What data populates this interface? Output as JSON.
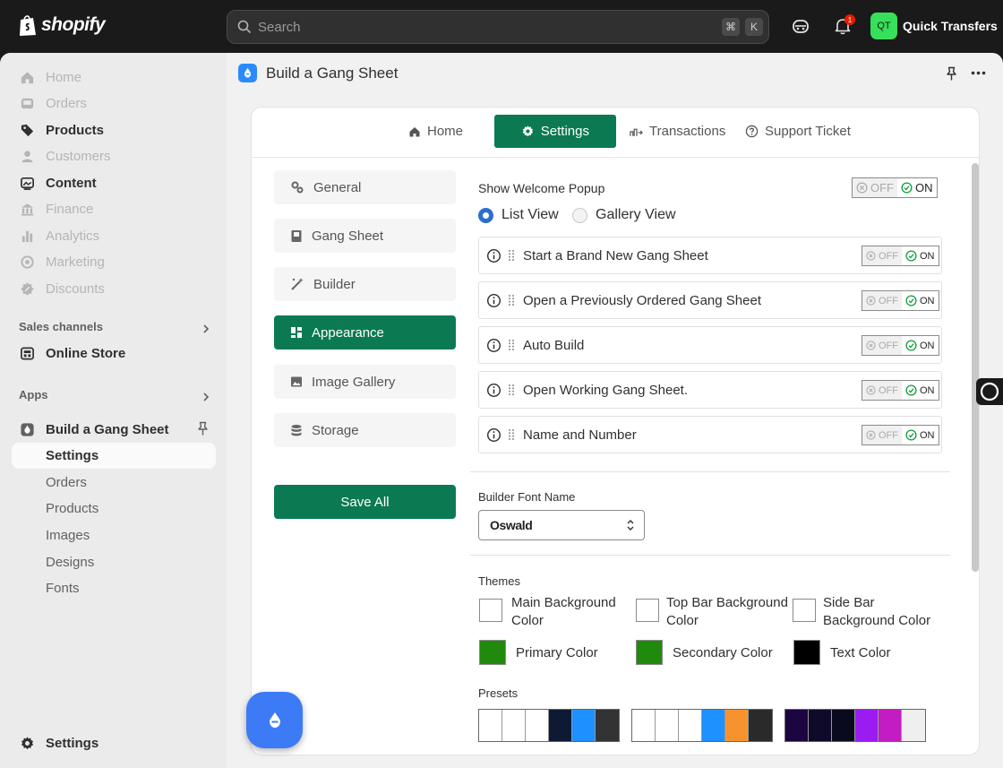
{
  "topbar": {
    "logo_text": "shopify",
    "search_placeholder": "Search",
    "shortcut_keys": [
      "⌘",
      "K"
    ],
    "notification_count": "1",
    "avatar_initials": "QT",
    "store_name": "Quick Transfers"
  },
  "sidebar": {
    "items": [
      {
        "label": "Home",
        "icon": "home-icon",
        "state": "dim"
      },
      {
        "label": "Orders",
        "icon": "inbox-icon",
        "state": "dim"
      },
      {
        "label": "Products",
        "icon": "tag-icon",
        "state": "dark"
      },
      {
        "label": "Customers",
        "icon": "person-icon",
        "state": "dim"
      },
      {
        "label": "Content",
        "icon": "content-icon",
        "state": "dark"
      },
      {
        "label": "Finance",
        "icon": "bank-icon",
        "state": "dim"
      },
      {
        "label": "Analytics",
        "icon": "bar-chart-icon",
        "state": "dim"
      },
      {
        "label": "Marketing",
        "icon": "target-icon",
        "state": "dim"
      },
      {
        "label": "Discounts",
        "icon": "discount-icon",
        "state": "dim"
      }
    ],
    "sales_channels_label": "Sales channels",
    "online_store_label": "Online Store",
    "apps_label": "Apps",
    "app_name": "Build a Gang Sheet",
    "app_subitems": [
      "Settings",
      "Orders",
      "Products",
      "Images",
      "Designs",
      "Fonts"
    ],
    "settings_label": "Settings"
  },
  "header": {
    "title": "Build a Gang Sheet"
  },
  "tabs": [
    "Home",
    "Settings",
    "Transactions",
    "Support Ticket"
  ],
  "active_tab": "Settings",
  "settings_menu": {
    "items": [
      "General",
      "Gang Sheet",
      "Builder",
      "Appearance",
      "Image Gallery",
      "Storage"
    ],
    "active": "Appearance",
    "save_label": "Save All"
  },
  "appearance": {
    "welcome_popup_label": "Show Welcome Popup",
    "off_label": "OFF",
    "on_label": "ON",
    "view_options": [
      "List View",
      "Gallery View"
    ],
    "selected_view": "List View",
    "options": [
      {
        "label": "Start a Brand New Gang Sheet",
        "enabled": true
      },
      {
        "label": "Open a Previously Ordered Gang Sheet",
        "enabled": true
      },
      {
        "label": "Auto Build",
        "enabled": true
      },
      {
        "label": "Open Working Gang Sheet.",
        "enabled": true
      },
      {
        "label": "Name and Number",
        "enabled": true
      }
    ],
    "font_label": "Builder Font Name",
    "font_value": "Oswald",
    "themes_label": "Themes",
    "theme_colors": [
      {
        "label": "Main Background Color",
        "color": "#ffffff"
      },
      {
        "label": "Top Bar Background Color",
        "color": "#ffffff"
      },
      {
        "label": "Side Bar Background Color",
        "color": "#ffffff"
      },
      {
        "label": "Primary Color",
        "color": "#1f8a0b"
      },
      {
        "label": "Secondary Color",
        "color": "#1f8a0b"
      },
      {
        "label": "Text Color",
        "color": "#000000"
      }
    ],
    "presets_label": "Presets",
    "presets": [
      [
        "#ffffff",
        "#ffffff",
        "#ffffff",
        "#0e1a33",
        "#1e90ff",
        "#333333"
      ],
      [
        "#ffffff",
        "#ffffff",
        "#ffffff",
        "#1e90ff",
        "#f7932f",
        "#2a2a2a"
      ],
      [
        "#1c0540",
        "#0f0a2a",
        "#0a0a1f",
        "#9b1cf0",
        "#c41cc4",
        "#efefef"
      ]
    ]
  },
  "colors": {
    "accent": "#0b7a52",
    "topbar": "#1a1a1a",
    "app_blue": "#3d7bf6"
  }
}
